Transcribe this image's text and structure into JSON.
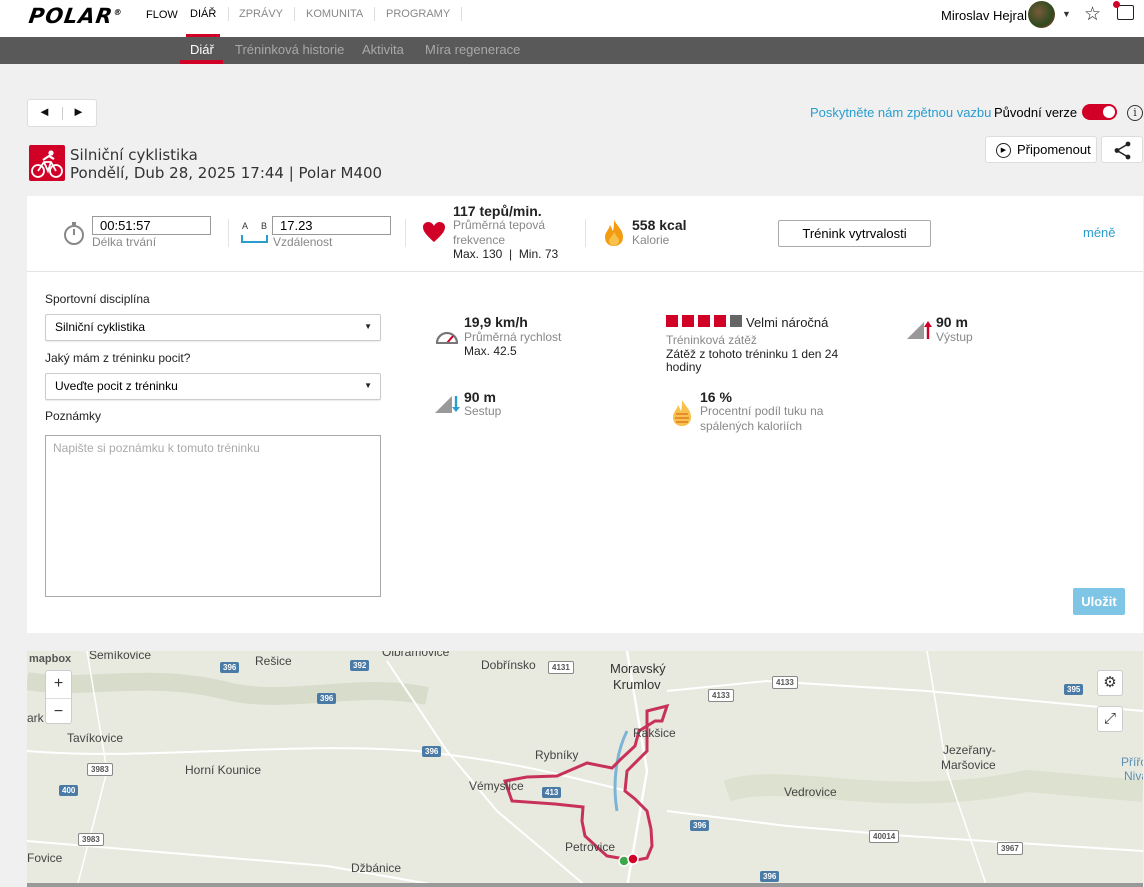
{
  "app": {
    "logo": "POLAR",
    "nav": [
      "FLOW",
      "DIÁŘ",
      "ZPRÁVY",
      "KOMUNITA",
      "PROGRAMY"
    ],
    "user_name": "Miroslav Hejral",
    "icons": {
      "favorites": "star-icon",
      "messages": "message-icon"
    },
    "colors": {
      "accent": "#d10027",
      "link": "#2a9dcf"
    }
  },
  "subnav": [
    "Diář",
    "Tréninková historie",
    "Aktivita",
    "Míra regenerace"
  ],
  "toolbar": {
    "prev": "◄",
    "next": "►",
    "feedback": "Poskytněte nám zpětnou vazbu",
    "original_version": "Původní verze",
    "original_version_on": true,
    "info": "i",
    "remind": "Připomenout"
  },
  "session": {
    "sport": "Silniční cyklistika",
    "datetime": "Pondělí, Dub 28, 2025 17:44 | Polar M400"
  },
  "summary": {
    "duration_value": "00:51:57",
    "duration_label": "Délka trvání",
    "ab_a": "A",
    "ab_b": "B",
    "distance_value": "17.23",
    "distance_label": "Vzdálenost",
    "hr_value": "117 tepů/min.",
    "hr_label_1": "Průměrná tepová",
    "hr_label_2": "frekvence",
    "hr_maxmin": "Max. 130  |  Min. 73",
    "kcal_value": "558 kcal",
    "kcal_label": "Kalorie",
    "benefit_button": "Trénink vytrvalosti",
    "less_link": "méně"
  },
  "form": {
    "sport_label": "Sportovní disciplína",
    "sport_value": "Silniční cyklistika",
    "feeling_label": "Jaký mám z tréninku pocit?",
    "feeling_value": "Uveďte pocit z tréninku",
    "notes_label": "Poznámky",
    "notes_placeholder": "Napište si poznámku k tomuto tréninku",
    "save": "Uložit"
  },
  "details": {
    "speed_value": "19,9 km/h",
    "speed_label": "Průměrná rychlost",
    "speed_max": "Max. 42.5",
    "load_level": "Velmi náročná",
    "load_bars_filled": 4,
    "load_bars_total": 5,
    "load_label": "Tréninková zátěž",
    "load_desc_1": "Zátěž z tohoto tréninku 1 den 24",
    "load_desc_2": "hodiny",
    "ascent_value": "90 m",
    "ascent_label": "Výstup",
    "descent_value": "90 m",
    "descent_label": "Sestup",
    "fat_value": "16 %",
    "fat_label_1": "Procentní podíl tuku na",
    "fat_label_2": "spálených kaloriích"
  },
  "map": {
    "attribution": "mapbox",
    "zoom_in": "+",
    "zoom_out": "−",
    "places": [
      "Šemíkovice",
      "Rešice",
      "Olbramovice",
      "Dobřínsko",
      "Moravský",
      "Krumlov",
      "Tavíkovice",
      "Horní Kounice",
      "Vémyslice",
      "Rakšice",
      "Petrovice",
      "Vedrovice",
      "Jezeřany-",
      "Maršovice",
      "Džbánice",
      "Fovice",
      "Přířo",
      "Niva",
      "Rybníky",
      "ark"
    ],
    "roads": [
      "396",
      "392",
      "4131",
      "4133",
      "4133",
      "396",
      "396",
      "3983",
      "400",
      "413",
      "395",
      "3983",
      "396",
      "40014",
      "3967",
      "396"
    ]
  }
}
